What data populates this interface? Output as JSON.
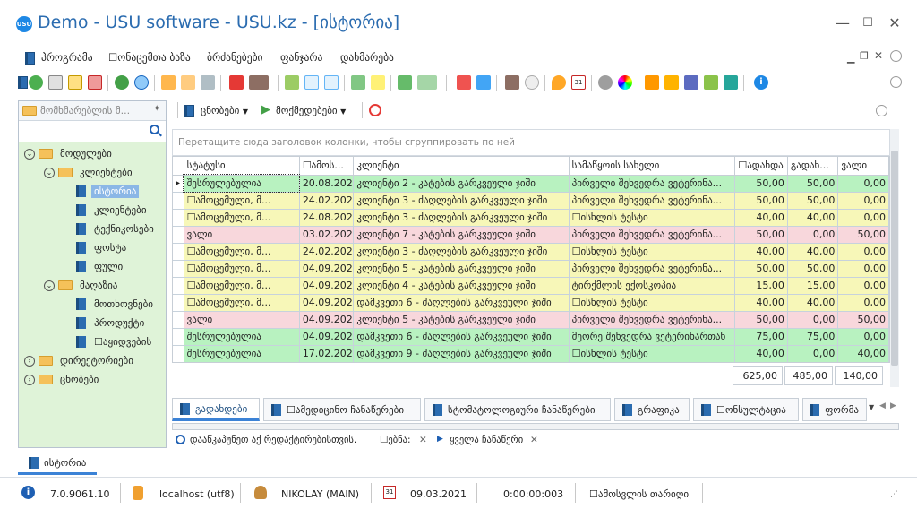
{
  "window": {
    "logo_text": "USU",
    "title": "Demo - USU software - USU.kz - [ისტორია]",
    "min": "—",
    "max": "☐",
    "close": "✕"
  },
  "menu": {
    "items": [
      "პროგრამა",
      "☐ონაცემთა ბაზა",
      "ბრძანებები",
      "ფანჯარა",
      "დახმარება"
    ]
  },
  "left_panel": {
    "header": "მომხმარებლის მ...",
    "pin": "✦",
    "search_icon": "search-icon",
    "tree": [
      {
        "label": "მოდულები",
        "level": 0,
        "type": "folder",
        "expander": "⌄"
      },
      {
        "label": "კლიენტები",
        "level": 1,
        "type": "folder",
        "expander": "⌄"
      },
      {
        "label": "ისტორია",
        "level": 2,
        "type": "doc",
        "selected": true
      },
      {
        "label": "კლიენტები",
        "level": 2,
        "type": "doc"
      },
      {
        "label": "ტექნიკოსები",
        "level": 2,
        "type": "doc"
      },
      {
        "label": "ფოსტა",
        "level": 2,
        "type": "doc"
      },
      {
        "label": "ფული",
        "level": 2,
        "type": "doc"
      },
      {
        "label": "მაღაზია",
        "level": 1,
        "type": "folder",
        "expander": "⌄"
      },
      {
        "label": "მოთხოვნები",
        "level": 2,
        "type": "doc"
      },
      {
        "label": "პროდუქტი",
        "level": 2,
        "type": "doc"
      },
      {
        "label": "☐აყიდვების",
        "level": 2,
        "type": "doc"
      },
      {
        "label": "დირექტორიები",
        "level": 0,
        "type": "folder",
        "expander": "›"
      },
      {
        "label": "ცნობები",
        "level": 0,
        "type": "folder",
        "expander": "›"
      }
    ]
  },
  "right_toolbar": {
    "reports": "ცნობები",
    "actions": "მოქმედებები"
  },
  "grid": {
    "group_hint": "Перетащите сюда заголовок колонки, чтобы сгруппировать по ней",
    "columns": [
      "სტატუსი",
      "☐ამოს...",
      "კლიენტი",
      "სამაწყოის სახელი",
      "☐ადახდა",
      "გადახ...",
      "ვალი"
    ],
    "rows": [
      {
        "status": "შესრულებულია",
        "date": "20.08.2020",
        "client": "კლიენტი 2 - კატების გარკვეული ჯიში",
        "name": "პირველი შეხვედრა ვეტერინა...",
        "total": "50,00",
        "paid": "50,00",
        "debt": "0,00",
        "color": "green",
        "current": true
      },
      {
        "status": "☐ამოცემული, მ...",
        "date": "24.02.2021",
        "client": "კლიენტი 3 - ძაღლების გარკვეული ჯიში",
        "name": "პირველი შეხვედრა ვეტერინა...",
        "total": "50,00",
        "paid": "50,00",
        "debt": "0,00",
        "color": "yellow"
      },
      {
        "status": "☐ამოცემული, მ...",
        "date": "24.08.2020",
        "client": "კლიენტი 3 - ძაღლების გარკვეული ჯიში",
        "name": "☐ისხლის ტესტი",
        "total": "40,00",
        "paid": "40,00",
        "debt": "0,00",
        "color": "yellow"
      },
      {
        "status": "ვალი",
        "date": "03.02.2021",
        "client": "კლიენტი 7 - კატების გარკვეული ჯიში",
        "name": "პირველი შეხვედრა ვეტერინა...",
        "total": "50,00",
        "paid": "0,00",
        "debt": "50,00",
        "color": "pink"
      },
      {
        "status": "☐ამოცემული, მ...",
        "date": "24.02.2021",
        "client": "კლიენტი 3 - ძაღლების გარკვეული ჯიში",
        "name": "☐ისხლის ტესტი",
        "total": "40,00",
        "paid": "40,00",
        "debt": "0,00",
        "color": "yellow"
      },
      {
        "status": "☐ამოცემული, მ...",
        "date": "04.09.2020",
        "client": "კლიენტი 5 - კატების გარკვეული ჯიში",
        "name": "პირველი შეხვედრა ვეტერინა...",
        "total": "50,00",
        "paid": "50,00",
        "debt": "0,00",
        "color": "yellow"
      },
      {
        "status": "☐ამოცემული, მ...",
        "date": "04.09.2020",
        "client": "კლიენტი 4 - კატების გარკვეული ჯიში",
        "name": "ტირქმლის ექოსკოპია",
        "total": "15,00",
        "paid": "15,00",
        "debt": "0,00",
        "color": "yellow"
      },
      {
        "status": "☐ამოცემული, მ...",
        "date": "04.09.2020",
        "client": "დამკვეთი 6 - ძაღლების გარკვეული ჯიში",
        "name": "☐ისხლის ტესტი",
        "total": "40,00",
        "paid": "40,00",
        "debt": "0,00",
        "color": "yellow"
      },
      {
        "status": "ვალი",
        "date": "04.09.2020",
        "client": "კლიენტი 5 - კატების გარკვეული ჯიში",
        "name": "პირველი შეხვედრა ვეტერინა...",
        "total": "50,00",
        "paid": "0,00",
        "debt": "50,00",
        "color": "pink"
      },
      {
        "status": "შესრულებულია",
        "date": "04.09.2020",
        "client": "დამკვეთი 6 - ძაღლების გარკვეული ჯიში",
        "name": "მეორე შეხვედრა ვეტერინართან",
        "total": "75,00",
        "paid": "75,00",
        "debt": "0,00",
        "color": "green"
      },
      {
        "status": "შესრულებულია",
        "date": "17.02.2021",
        "client": "დამკვეთი 9 - ძაღლების გარკვეული ჯიში",
        "name": "☐ისხლის ტესტი",
        "total": "40,00",
        "paid": "0,00",
        "debt": "40,00",
        "color": "green"
      }
    ],
    "totals": {
      "total": "625,00",
      "paid": "485,00",
      "debt": "140,00"
    }
  },
  "tabs": [
    "გადახდები",
    "☐ამედიცინო ჩანაწერები",
    "სტომატოლოგიური ჩანაწერები",
    "გრაფიკა",
    "☐ონსულტაცია",
    "ფორმა"
  ],
  "filter": {
    "search_text": "დააწკაპუნეთ აქ რედაქტირებისთვის.",
    "mode_label": "☐ებნა:",
    "all_records": "ყველა ჩანაწერი"
  },
  "bottom_tab": "ისტორია",
  "status": {
    "version": "7.0.9061.10",
    "db": "localhost (utf8)",
    "user": "NIKOLAY (MAIN)",
    "date": "09.03.2021",
    "timer": "0:00:00:003",
    "exit_date": "☐ამოსვლის თარიღი"
  },
  "colors": {
    "green": "#b8f2c0",
    "yellow": "#f7f7b8",
    "pink": "#f8d7dc",
    "accent": "#3b82d6",
    "title_blue": "#2b6cb0"
  }
}
